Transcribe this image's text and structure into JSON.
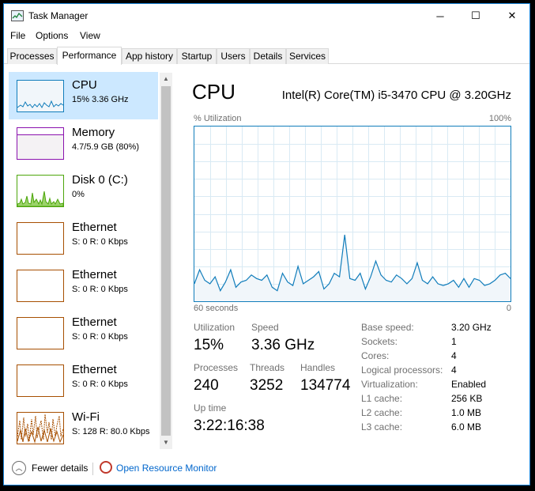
{
  "titlebar": {
    "title": "Task Manager",
    "minimize": "─",
    "maximize": "☐",
    "close": "✕"
  },
  "menu": [
    "File",
    "Options",
    "View"
  ],
  "tabs": [
    "Processes",
    "Performance",
    "App history",
    "Startup",
    "Users",
    "Details",
    "Services"
  ],
  "active_tab": "Performance",
  "sidebar": {
    "items": [
      {
        "title": "CPU",
        "subtitle": "15% 3.36 GHz",
        "color": "#117dbb",
        "fill": "#f1f6fa",
        "selected": true
      },
      {
        "title": "Memory",
        "subtitle": "4.7/5.9 GB (80%)",
        "color": "#8b12ae",
        "fill": "#f4f2f4",
        "selected": false
      },
      {
        "title": "Disk 0 (C:)",
        "subtitle": "0%",
        "color": "#4da60c",
        "fill": "#ffffff",
        "selected": false
      },
      {
        "title": "Ethernet",
        "subtitle": "S: 0 R: 0 Kbps",
        "color": "#a74f01",
        "fill": "#ffffff",
        "selected": false
      },
      {
        "title": "Ethernet",
        "subtitle": "S: 0 R: 0 Kbps",
        "color": "#a74f01",
        "fill": "#ffffff",
        "selected": false
      },
      {
        "title": "Ethernet",
        "subtitle": "S: 0 R: 0 Kbps",
        "color": "#a74f01",
        "fill": "#ffffff",
        "selected": false
      },
      {
        "title": "Ethernet",
        "subtitle": "S: 0 R: 0 Kbps",
        "color": "#a74f01",
        "fill": "#ffffff",
        "selected": false
      },
      {
        "title": "Wi-Fi",
        "subtitle": "S: 128 R: 80.0 Kbps",
        "color": "#a74f01",
        "fill": "#ffffff",
        "selected": false
      }
    ],
    "memory_level": 0.8
  },
  "main": {
    "title": "CPU",
    "model": "Intel(R) Core(TM) i5-3470 CPU @ 3.20GHz",
    "graph_label": "% Utilization",
    "graph_max": "100%",
    "graph_time": "60 seconds",
    "graph_min": "0",
    "stats": {
      "utilization_label": "Utilization",
      "utilization": "15%",
      "speed_label": "Speed",
      "speed": "3.36 GHz",
      "processes_label": "Processes",
      "processes": "240",
      "threads_label": "Threads",
      "threads": "3252",
      "handles_label": "Handles",
      "handles": "134774",
      "uptime_label": "Up time",
      "uptime": "3:22:16:38"
    },
    "specs": [
      {
        "label": "Base speed:",
        "value": "3.20 GHz"
      },
      {
        "label": "Sockets:",
        "value": "1"
      },
      {
        "label": "Cores:",
        "value": "4"
      },
      {
        "label": "Logical processors:",
        "value": "4"
      },
      {
        "label": "Virtualization:",
        "value": "Enabled"
      },
      {
        "label": "L1 cache:",
        "value": "256 KB"
      },
      {
        "label": "L2 cache:",
        "value": "1.0 MB"
      },
      {
        "label": "L3 cache:",
        "value": "6.0 MB"
      }
    ]
  },
  "footer": {
    "fewer_details": "Fewer details",
    "resource_monitor": "Open Resource Monitor"
  },
  "chart_data": {
    "type": "area",
    "ylim": [
      0,
      100
    ],
    "series": [
      {
        "values": [
          10,
          18,
          12,
          10,
          14,
          6,
          11,
          18,
          8,
          11,
          12,
          15,
          13,
          12,
          15,
          8,
          6,
          16,
          11,
          9,
          20,
          10,
          12,
          14,
          17,
          7,
          10,
          16,
          14,
          38,
          13,
          12,
          16,
          7,
          14,
          23,
          15,
          12,
          11,
          15,
          13,
          10,
          13,
          22,
          12,
          10,
          14,
          10,
          9,
          10,
          12,
          8,
          13,
          8,
          13,
          12,
          9,
          10,
          12,
          15,
          16,
          13
        ]
      }
    ]
  }
}
